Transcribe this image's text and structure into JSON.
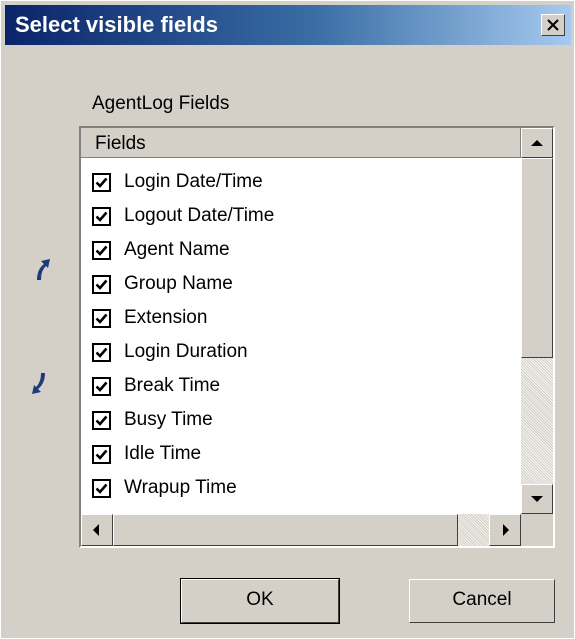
{
  "window": {
    "title": "Select visible fields"
  },
  "group": {
    "label": "AgentLog Fields"
  },
  "list": {
    "column_header": "Fields",
    "items": [
      {
        "label": "Login Date/Time",
        "checked": true
      },
      {
        "label": "Logout Date/Time",
        "checked": true
      },
      {
        "label": "Agent Name",
        "checked": true
      },
      {
        "label": "Group Name",
        "checked": true
      },
      {
        "label": "Extension",
        "checked": true
      },
      {
        "label": "Login Duration",
        "checked": true
      },
      {
        "label": "Break Time",
        "checked": true
      },
      {
        "label": "Busy Time",
        "checked": true
      },
      {
        "label": "Idle Time",
        "checked": true
      },
      {
        "label": "Wrapup Time",
        "checked": true
      }
    ]
  },
  "buttons": {
    "ok": "OK",
    "cancel": "Cancel"
  },
  "icons": {
    "close": "close-icon",
    "move_up": "move-up-arrow-icon",
    "move_down": "move-down-arrow-icon"
  },
  "colors": {
    "titlebar_start": "#0a246a",
    "titlebar_end": "#a6caf0",
    "face": "#d4d0c8",
    "arrow": "#1f3a7a"
  }
}
